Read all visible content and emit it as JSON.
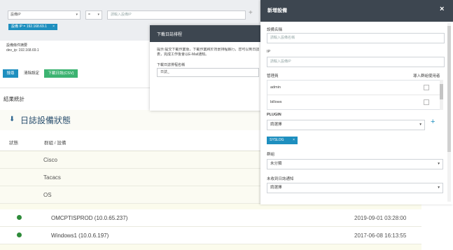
{
  "filter": {
    "device_ip_select": "設備IP",
    "operator_select": "=",
    "ip_input_placeholder": "請輸入設備IP",
    "add_symbol": "+",
    "chip_label": "設備 IP = 192.168.69.1",
    "chip_close": "×",
    "info_line1": "設備條件摘要",
    "info_line2": "dev_ip: 192.168.69.1"
  },
  "buttons": {
    "search": "搜尋",
    "clear": "清除設定",
    "download_csv": "下載日誌(CSV)"
  },
  "results_label": "結果統計",
  "log_panel": {
    "title": "日誌設備狀態",
    "col_status": "狀態",
    "col_group": "群組 / 設備",
    "groups": [
      "Cisco",
      "Tacacs",
      "OS"
    ],
    "devices": [
      {
        "name": "OMCPTISPROD (10.0.65.237)",
        "time": "2019-09-01 03:28:00"
      },
      {
        "name": "Windows1 (10.0.6.197)",
        "time": "2017-06-08 16:13:55"
      }
    ]
  },
  "download_dialog": {
    "title": "下載日誌排程",
    "message_line1": "提示:提交下載作業後，下載作業將於背景排程執行，您可以到日誌報",
    "message_line2": "表，完成工作後會以E-Mail通知。",
    "name_label": "下載日誌排程名稱",
    "name_value": "日誌_"
  },
  "add_device_panel": {
    "title": "新增設備",
    "close": "×",
    "device_name_label": "設備名稱",
    "device_name_placeholder": "請輸入設備名稱",
    "ip_label": "IP",
    "ip_placeholder": "請輸入設備IP",
    "admin_label": "管理員",
    "admin_hint": "導入群組使用者",
    "admins": [
      "admin",
      "billows"
    ],
    "plugin_label": "PLUGIN",
    "plugin_select": "請選擇",
    "plugin_add": "+",
    "plugin_chip": "SYSLOG",
    "plugin_chip_close": "×",
    "group_label": "群組",
    "group_select": "未分類",
    "notify_label": "未收到日誌通知",
    "notify_select": "請選擇"
  },
  "colors": {
    "accent": "#1e8fbf",
    "download_green": "#3cb371",
    "header_dark": "#3d4650",
    "status_green": "#2e8b3a"
  }
}
